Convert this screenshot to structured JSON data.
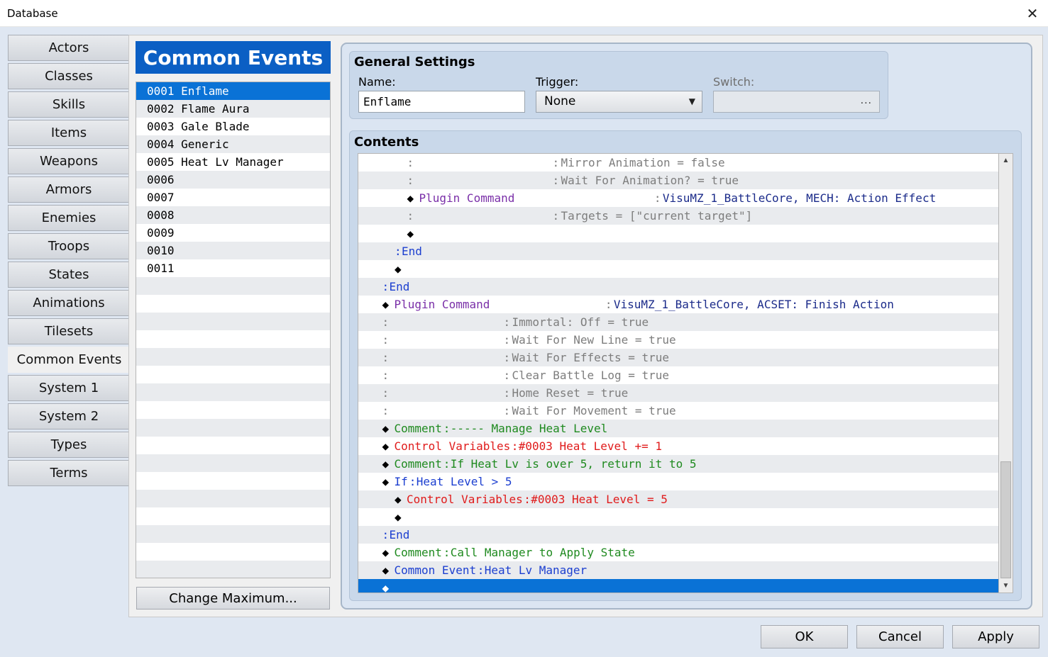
{
  "window": {
    "title": "Database",
    "close_icon": "close-icon"
  },
  "tabs": [
    {
      "label": "Actors",
      "active": false
    },
    {
      "label": "Classes",
      "active": false
    },
    {
      "label": "Skills",
      "active": false
    },
    {
      "label": "Items",
      "active": false
    },
    {
      "label": "Weapons",
      "active": false
    },
    {
      "label": "Armors",
      "active": false
    },
    {
      "label": "Enemies",
      "active": false
    },
    {
      "label": "Troops",
      "active": false
    },
    {
      "label": "States",
      "active": false
    },
    {
      "label": "Animations",
      "active": false
    },
    {
      "label": "Tilesets",
      "active": false
    },
    {
      "label": "Common Events",
      "active": true
    },
    {
      "label": "System 1",
      "active": false
    },
    {
      "label": "System 2",
      "active": false
    },
    {
      "label": "Types",
      "active": false
    },
    {
      "label": "Terms",
      "active": false
    }
  ],
  "common_events": {
    "header": "Common Events",
    "items": [
      {
        "label": "0001 Enflame",
        "selected": true
      },
      {
        "label": "0002 Flame Aura",
        "selected": false
      },
      {
        "label": "0003 Gale Blade",
        "selected": false
      },
      {
        "label": "0004 Generic",
        "selected": false
      },
      {
        "label": "0005 Heat Lv Manager",
        "selected": false
      },
      {
        "label": "0006",
        "selected": false
      },
      {
        "label": "0007",
        "selected": false
      },
      {
        "label": "0008",
        "selected": false
      },
      {
        "label": "0009",
        "selected": false
      },
      {
        "label": "0010",
        "selected": false
      },
      {
        "label": "0011",
        "selected": false
      }
    ],
    "change_maximum": "Change Maximum..."
  },
  "general_settings": {
    "title": "General Settings",
    "name_label": "Name:",
    "name_value": "Enflame",
    "trigger_label": "Trigger:",
    "trigger_value": "None",
    "switch_label": "Switch:",
    "switch_button": "..."
  },
  "contents": {
    "title": "Contents",
    "lines": [
      {
        "indent": 3,
        "segments": [
          {
            "text": ":",
            "color": "gray"
          },
          {
            "text": ":",
            "color": "gray",
            "col": "param2"
          },
          {
            "text": "Mirror Animation = false",
            "color": "gray",
            "col": "param2v"
          }
        ]
      },
      {
        "indent": 3,
        "segments": [
          {
            "text": ":",
            "color": "gray"
          },
          {
            "text": ":",
            "color": "gray",
            "col": "param2"
          },
          {
            "text": "Wait For Animation? = true",
            "color": "gray",
            "col": "param2v"
          }
        ]
      },
      {
        "indent": 3,
        "segments": [
          {
            "text": "◆",
            "color": "black"
          },
          {
            "text": "Plugin Command",
            "color": "purple"
          },
          {
            "text": ":",
            "color": "gray",
            "col": "param2"
          },
          {
            "text": "VisuMZ_1_BattleCore, MECH: Action Effect",
            "color": "navy",
            "col": "param2v"
          }
        ]
      },
      {
        "indent": 3,
        "segments": [
          {
            "text": ":",
            "color": "gray"
          },
          {
            "text": ":",
            "color": "gray",
            "col": "param2"
          },
          {
            "text": "Targets = [\"current target\"]",
            "color": "gray",
            "col": "param2v"
          }
        ]
      },
      {
        "indent": 3,
        "segments": [
          {
            "text": "◆",
            "color": "black"
          }
        ]
      },
      {
        "indent": 2,
        "segments": [
          {
            "text": ":",
            "color": "blue"
          },
          {
            "text": "End",
            "color": "blue"
          }
        ]
      },
      {
        "indent": 2,
        "segments": [
          {
            "text": "◆",
            "color": "black"
          }
        ]
      },
      {
        "indent": 1,
        "segments": [
          {
            "text": ":",
            "color": "blue"
          },
          {
            "text": "End",
            "color": "blue"
          }
        ]
      },
      {
        "indent": 1,
        "segments": [
          {
            "text": "◆",
            "color": "black"
          },
          {
            "text": "Plugin Command",
            "color": "purple"
          },
          {
            "text": ":",
            "color": "gray",
            "col": "param1"
          },
          {
            "text": "VisuMZ_1_BattleCore, ACSET: Finish Action",
            "color": "navy",
            "col": "param1v"
          }
        ]
      },
      {
        "indent": 1,
        "segments": [
          {
            "text": ":",
            "color": "gray"
          },
          {
            "text": ":",
            "color": "gray",
            "col": "param1"
          },
          {
            "text": "Immortal: Off = true",
            "color": "gray",
            "col": "param1v"
          }
        ]
      },
      {
        "indent": 1,
        "segments": [
          {
            "text": ":",
            "color": "gray"
          },
          {
            "text": ":",
            "color": "gray",
            "col": "param1"
          },
          {
            "text": "Wait For New Line = true",
            "color": "gray",
            "col": "param1v"
          }
        ]
      },
      {
        "indent": 1,
        "segments": [
          {
            "text": ":",
            "color": "gray"
          },
          {
            "text": ":",
            "color": "gray",
            "col": "param1"
          },
          {
            "text": "Wait For Effects = true",
            "color": "gray",
            "col": "param1v"
          }
        ]
      },
      {
        "indent": 1,
        "segments": [
          {
            "text": ":",
            "color": "gray"
          },
          {
            "text": ":",
            "color": "gray",
            "col": "param1"
          },
          {
            "text": "Clear Battle Log = true",
            "color": "gray",
            "col": "param1v"
          }
        ]
      },
      {
        "indent": 1,
        "segments": [
          {
            "text": ":",
            "color": "gray"
          },
          {
            "text": ":",
            "color": "gray",
            "col": "param1"
          },
          {
            "text": "Home Reset = true",
            "color": "gray",
            "col": "param1v"
          }
        ]
      },
      {
        "indent": 1,
        "segments": [
          {
            "text": ":",
            "color": "gray"
          },
          {
            "text": ":",
            "color": "gray",
            "col": "param1"
          },
          {
            "text": "Wait For Movement = true",
            "color": "gray",
            "col": "param1v"
          }
        ]
      },
      {
        "indent": 1,
        "segments": [
          {
            "text": "◆",
            "color": "black"
          },
          {
            "text": "Comment",
            "color": "green"
          },
          {
            "text": ":",
            "color": "green"
          },
          {
            "text": "----- Manage Heat Level",
            "color": "green"
          }
        ]
      },
      {
        "indent": 1,
        "segments": [
          {
            "text": "◆",
            "color": "black"
          },
          {
            "text": "Control Variables",
            "color": "red"
          },
          {
            "text": ":",
            "color": "red"
          },
          {
            "text": "#0003 Heat Level += 1",
            "color": "red"
          }
        ]
      },
      {
        "indent": 1,
        "segments": [
          {
            "text": "◆",
            "color": "black"
          },
          {
            "text": "Comment",
            "color": "green"
          },
          {
            "text": ":",
            "color": "green"
          },
          {
            "text": "If Heat Lv is over 5, return it to 5",
            "color": "green"
          }
        ]
      },
      {
        "indent": 1,
        "segments": [
          {
            "text": "◆",
            "color": "black"
          },
          {
            "text": "If",
            "color": "blue"
          },
          {
            "text": ":",
            "color": "blue"
          },
          {
            "text": "Heat Level > 5",
            "color": "blue"
          }
        ]
      },
      {
        "indent": 2,
        "segments": [
          {
            "text": "◆",
            "color": "black"
          },
          {
            "text": "Control Variables",
            "color": "red"
          },
          {
            "text": ":",
            "color": "red"
          },
          {
            "text": "#0003 Heat Level = 5",
            "color": "red"
          }
        ]
      },
      {
        "indent": 2,
        "segments": [
          {
            "text": "◆",
            "color": "black"
          }
        ]
      },
      {
        "indent": 1,
        "segments": [
          {
            "text": ":",
            "color": "blue"
          },
          {
            "text": "End",
            "color": "blue"
          }
        ]
      },
      {
        "indent": 1,
        "segments": [
          {
            "text": "◆",
            "color": "black"
          },
          {
            "text": "Comment",
            "color": "green"
          },
          {
            "text": ":",
            "color": "green"
          },
          {
            "text": "Call Manager to Apply State",
            "color": "green"
          }
        ]
      },
      {
        "indent": 1,
        "segments": [
          {
            "text": "◆",
            "color": "black"
          },
          {
            "text": "Common Event",
            "color": "blue"
          },
          {
            "text": ":",
            "color": "blue"
          },
          {
            "text": "Heat Lv Manager",
            "color": "blue"
          }
        ]
      },
      {
        "indent": 1,
        "selected": true,
        "segments": [
          {
            "text": "◆",
            "color": "white"
          }
        ]
      }
    ]
  },
  "scrollbar": {
    "up_icon": "scroll-up-arrow-icon",
    "down_icon": "scroll-down-arrow-icon",
    "up_glyph": "▲",
    "down_glyph": "▼"
  },
  "buttons": {
    "ok": "OK",
    "cancel": "Cancel",
    "apply": "Apply"
  }
}
